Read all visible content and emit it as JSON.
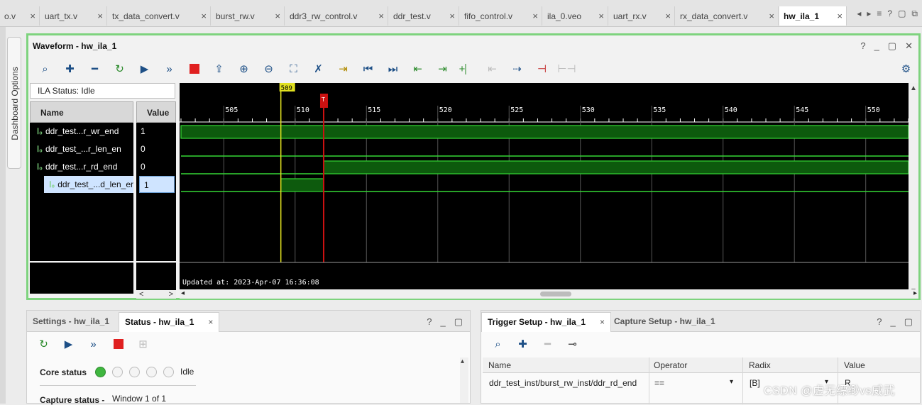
{
  "editor_tabs": [
    {
      "label": "o.v",
      "active": false
    },
    {
      "label": "uart_tx.v",
      "active": false
    },
    {
      "label": "tx_data_convert.v",
      "active": false
    },
    {
      "label": "burst_rw.v",
      "active": false
    },
    {
      "label": "ddr3_rw_control.v",
      "active": false
    },
    {
      "label": "ddr_test.v",
      "active": false
    },
    {
      "label": "fifo_control.v",
      "active": false
    },
    {
      "label": "ila_0.veo",
      "active": false
    },
    {
      "label": "uart_rx.v",
      "active": false
    },
    {
      "label": "rx_data_convert.v",
      "active": false
    },
    {
      "label": "hw_ila_1",
      "active": true
    }
  ],
  "tab_close_glyph": "×",
  "tab_controls": [
    "◂",
    "▸",
    "≡",
    "?",
    "▢",
    "⧉"
  ],
  "dashboard_options": "Dashboard Options",
  "waveform": {
    "title": "Waveform - hw_ila_1",
    "window_controls": [
      "?",
      "_",
      "▢",
      "✕"
    ],
    "ila_status": "ILA Status: Idle",
    "col_name": "Name",
    "col_value": "Value",
    "signals": [
      {
        "name": "ddr_test...r_wr_end",
        "value": "1",
        "selected": false
      },
      {
        "name": "ddr_test_...r_len_en",
        "value": "0",
        "selected": false
      },
      {
        "name": "ddr_test...r_rd_end",
        "value": "0",
        "selected": false
      },
      {
        "name": "ddr_test_...d_len_er",
        "value": "1",
        "selected": true
      }
    ],
    "scroll_left": "<",
    "scroll_right": ">",
    "updated_at": "Updated at: 2023-Apr-07 16:36:08"
  },
  "chart_data": {
    "type": "timing",
    "x_ticks": [
      505,
      510,
      515,
      520,
      525,
      530,
      535,
      540,
      545,
      550
    ],
    "x_range": [
      502,
      553
    ],
    "cursor_marker": {
      "label": "509",
      "sample": 509,
      "color": "#e0e020"
    },
    "trigger_marker": {
      "label": "T",
      "sample": 512,
      "color": "#cc1111"
    },
    "signals": [
      {
        "name": "ddr_test...r_wr_end",
        "segments": [
          {
            "from": 502,
            "to": 553,
            "level": "high"
          }
        ]
      },
      {
        "name": "ddr_test_...r_len_en",
        "segments": [
          {
            "from": 502,
            "to": 553,
            "level": "low"
          }
        ]
      },
      {
        "name": "ddr_test...r_rd_end",
        "segments": [
          {
            "from": 502,
            "to": 512,
            "level": "low"
          },
          {
            "from": 512,
            "to": 553,
            "level": "high"
          }
        ]
      },
      {
        "name": "ddr_test_...d_len_er",
        "segments": [
          {
            "from": 502,
            "to": 509,
            "level": "low"
          },
          {
            "from": 509,
            "to": 512,
            "level": "high"
          },
          {
            "from": 512,
            "to": 553,
            "level": "low"
          }
        ]
      }
    ],
    "colors": {
      "background": "#000000",
      "wave": "#35d835",
      "fill": "#0d5a0d",
      "grid": "#555555"
    }
  },
  "settings_panel": {
    "tabs": [
      {
        "label": "Settings - hw_ila_1",
        "active": false
      },
      {
        "label": "Status - hw_ila_1",
        "active": true
      }
    ],
    "close_glyph": "×",
    "controls": [
      "?",
      "_",
      "▢"
    ],
    "core_status_label": "Core status",
    "core_status_value": "Idle",
    "capture_status_label": "Capture status -",
    "capture_status_value": "Window 1 of 1"
  },
  "trigger_panel": {
    "tabs": [
      {
        "label": "Trigger Setup - hw_ila_1",
        "active": true
      },
      {
        "label": "Capture Setup - hw_ila_1",
        "active": false
      }
    ],
    "close_glyph": "×",
    "controls": [
      "?",
      "_",
      "▢"
    ],
    "columns": [
      "Name",
      "Operator",
      "Radix",
      "Value"
    ],
    "row": {
      "name": "ddr_test_inst/burst_rw_inst/ddr_rd_end",
      "operator": "==",
      "radix": "[B]",
      "value": "R"
    }
  },
  "watermark": "CSDN @虚无缥缈vs威武"
}
